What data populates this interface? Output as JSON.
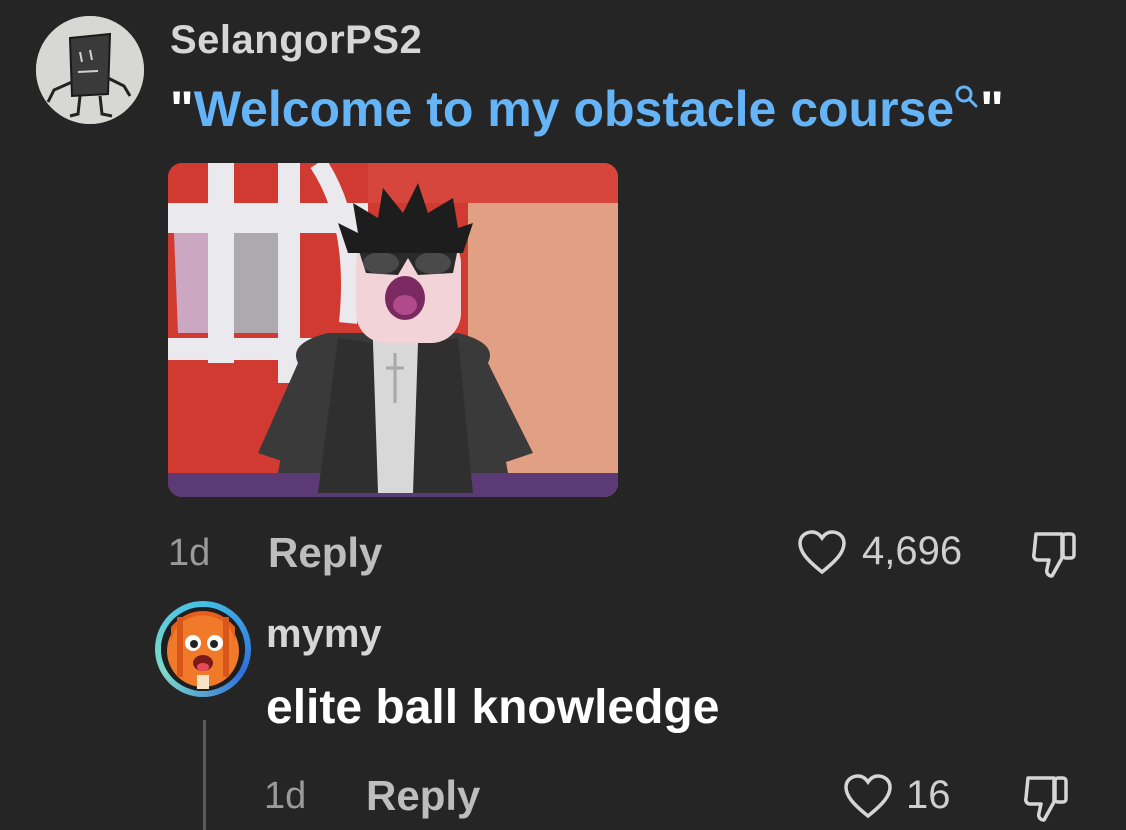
{
  "comment": {
    "username": "SelangorPS2",
    "quote_open": "\"",
    "link_text": "Welcome to my obstacle course",
    "quote_close": "\"",
    "age": "1d",
    "reply_label": "Reply",
    "like_count": "4,696",
    "avatar_icon": "block-character-avatar-icon",
    "media_icon": "roblox-character-image"
  },
  "reply": {
    "username": "mymy",
    "text": "elite ball knowledge",
    "age": "1d",
    "reply_label": "Reply",
    "like_count": "16",
    "avatar_icon": "orange-character-avatar-icon"
  },
  "colors": {
    "background": "#252525",
    "link": "#65b4f7",
    "muted": "#9b9b9b",
    "avatar_ring": "#43c0e8"
  }
}
